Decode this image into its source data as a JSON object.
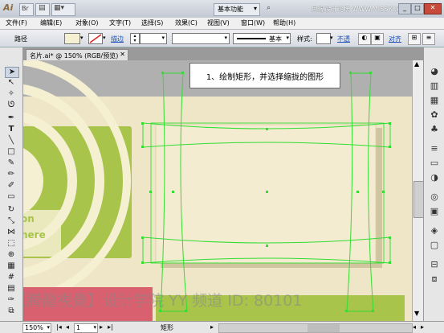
{
  "titlebar": {
    "app_logo": "Ai",
    "workspace_label": "基本功能",
    "watermark": "思缘设计论坛 WWW.MISSYUAN.COM"
  },
  "menubar": {
    "items": [
      "文件(F)",
      "编辑(E)",
      "对象(O)",
      "文字(T)",
      "选择(S)",
      "效果(C)",
      "视图(V)",
      "窗口(W)",
      "帮助(H)"
    ]
  },
  "controlbar": {
    "object_type": "路径",
    "stroke_label": "描边",
    "style_basic": "基本",
    "style_label": "样式:",
    "opacity_label": "不透",
    "align_label": "对齐"
  },
  "document_tab": {
    "title": "名片.ai* @ 150% (RGB/预览)"
  },
  "callout": {
    "text": "1、绘制矩形，并选择缩拢的图形"
  },
  "artwork": {
    "card_text_line1": "on",
    "card_text_line2": "here"
  },
  "watermark_bottom": {
    "text": "【腾龍視覺】设计学院 YY 频道 ID: 80101"
  },
  "statusbar": {
    "zoom": "150%",
    "page": "1",
    "tool_name": "矩形"
  },
  "colors": {
    "accent_green": "#a8c44a",
    "cream": "#f6f0d2",
    "selection": "#33dd33",
    "pink": "#d9606e"
  }
}
